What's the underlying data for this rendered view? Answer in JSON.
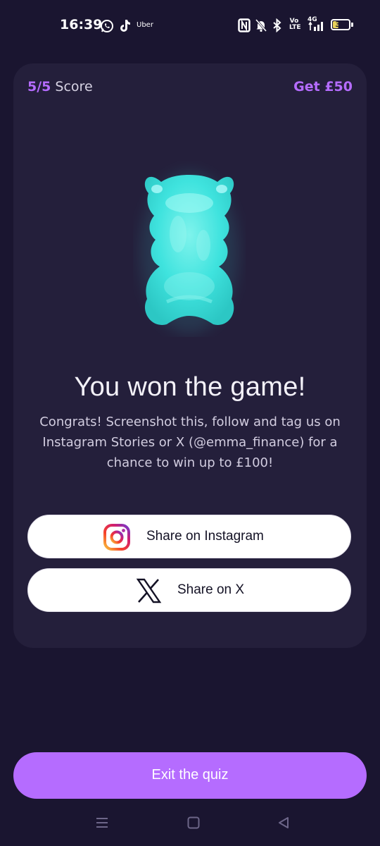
{
  "status_bar": {
    "time": "16:39",
    "apps": [
      "whatsapp-icon",
      "tiktok-icon",
      "uber-icon"
    ],
    "uber_text": "Uber",
    "network_label": "4G",
    "volte_label": "Vo LTE",
    "battery": "35",
    "battery_level": 0.35,
    "right_icons": [
      "nfc-icon",
      "muted-bell-icon",
      "bluetooth-icon",
      "volte-icon",
      "signal-icon",
      "battery-icon"
    ]
  },
  "card": {
    "score_value": "5/5",
    "score_label": " Score",
    "reward": "Get £50",
    "image": "gummy-bear-icon",
    "title": "You won the game!",
    "description": "Congrats! Screenshot this, follow and tag us on Instagram Stories or X (@emma_finance) for a chance to win up to £100!",
    "buttons": {
      "instagram": {
        "label": "Share on Instagram",
        "icon": "instagram-icon"
      },
      "x": {
        "label": "Share on X",
        "icon": "x-logo-icon"
      }
    }
  },
  "exit_button": {
    "label": "Exit the quiz"
  },
  "nav_bar": {
    "icons": [
      "menu-icon",
      "home-icon",
      "back-icon"
    ]
  },
  "colors": {
    "background": "#1a1530",
    "card": "#241f3b",
    "accent": "#b56cff",
    "bear": "#3fe3de"
  }
}
